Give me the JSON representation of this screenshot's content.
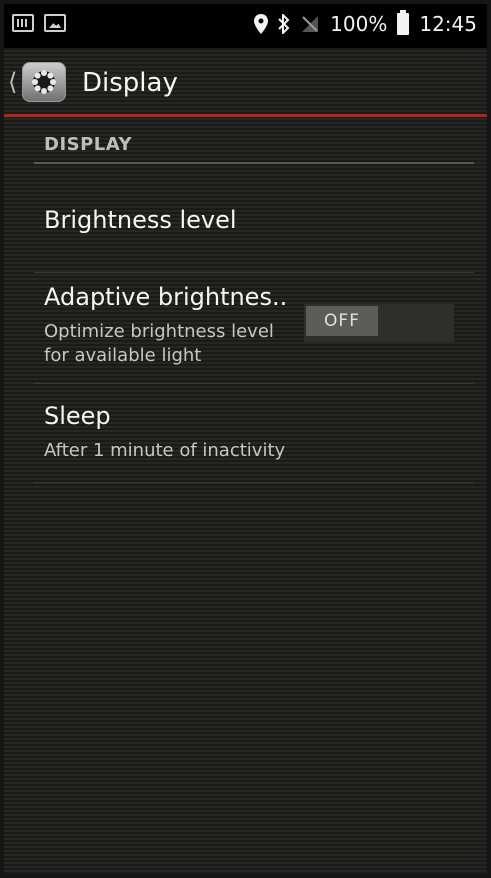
{
  "status_bar": {
    "battery_percent": "100%",
    "time": "12:45"
  },
  "action_bar": {
    "title": "Display"
  },
  "section": {
    "header": "DISPLAY"
  },
  "settings": [
    {
      "title": "Brightness level"
    },
    {
      "title": "Adaptive brightnes..",
      "subtitle_line1": "Optimize brightness level",
      "subtitle_line2": "for available light",
      "toggle_state": "OFF"
    },
    {
      "title": "Sleep",
      "subtitle": "After 1 minute of inactivity"
    }
  ],
  "colors": {
    "accent": "#b3241b"
  },
  "icons": [
    "keyboard-icon",
    "image-icon",
    "location-icon",
    "bluetooth-icon",
    "no-signal-icon",
    "battery-icon",
    "back-chevron-icon",
    "settings-gear-icon"
  ]
}
